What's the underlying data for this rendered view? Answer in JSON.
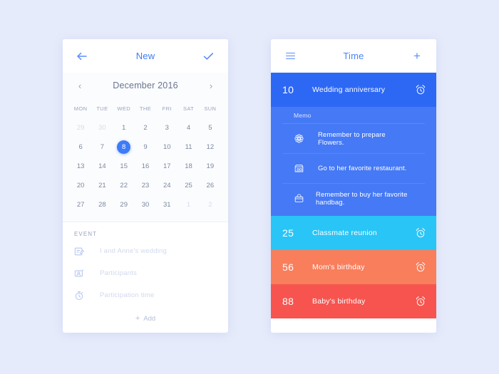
{
  "colors": {
    "page_background": "#e6ebfb",
    "accent_blue": "#3d7bf7",
    "row_blue": "#2d68f5",
    "memo_blue": "#4579f5",
    "row_cyan": "#29c5f6",
    "row_orange": "#f97e5c",
    "row_red": "#f7544f"
  },
  "left_panel": {
    "appbar": {
      "back_icon": "arrow-left-icon",
      "title": "New",
      "confirm_icon": "check-icon"
    },
    "month_nav": {
      "prev_icon": "chevron-left-icon",
      "label": "December 2016",
      "next_icon": "chevron-right-icon"
    },
    "calendar": {
      "weekdays": [
        "MON",
        "TUE",
        "WED",
        "THE",
        "FRI",
        "SAT",
        "SUN"
      ],
      "selected_day": 8,
      "weeks": [
        [
          {
            "n": "29",
            "muted": true
          },
          {
            "n": "30",
            "muted": true
          },
          {
            "n": "1",
            "muted": false
          },
          {
            "n": "2",
            "muted": false
          },
          {
            "n": "3",
            "muted": false
          },
          {
            "n": "4",
            "muted": false
          },
          {
            "n": "5",
            "muted": false
          }
        ],
        [
          {
            "n": "6",
            "muted": false
          },
          {
            "n": "7",
            "muted": false
          },
          {
            "n": "8",
            "muted": false,
            "selected": true
          },
          {
            "n": "9",
            "muted": false
          },
          {
            "n": "10",
            "muted": false
          },
          {
            "n": "11",
            "muted": false
          },
          {
            "n": "12",
            "muted": false
          }
        ],
        [
          {
            "n": "13",
            "muted": false
          },
          {
            "n": "14",
            "muted": false
          },
          {
            "n": "15",
            "muted": false
          },
          {
            "n": "16",
            "muted": false
          },
          {
            "n": "17",
            "muted": false
          },
          {
            "n": "18",
            "muted": false
          },
          {
            "n": "19",
            "muted": false
          }
        ],
        [
          {
            "n": "20",
            "muted": false
          },
          {
            "n": "21",
            "muted": false
          },
          {
            "n": "22",
            "muted": false
          },
          {
            "n": "23",
            "muted": false
          },
          {
            "n": "24",
            "muted": false
          },
          {
            "n": "25",
            "muted": false
          },
          {
            "n": "26",
            "muted": false
          }
        ],
        [
          {
            "n": "27",
            "muted": false
          },
          {
            "n": "28",
            "muted": false
          },
          {
            "n": "29",
            "muted": false
          },
          {
            "n": "30",
            "muted": false
          },
          {
            "n": "31",
            "muted": false
          },
          {
            "n": "1",
            "muted": true
          },
          {
            "n": "2",
            "muted": true
          }
        ]
      ]
    },
    "event_section": {
      "title": "EVENT",
      "rows": [
        {
          "icon": "edit-note-icon",
          "placeholder": "I and Anne's wedding"
        },
        {
          "icon": "contact-card-icon",
          "placeholder": "Participants"
        },
        {
          "icon": "stopwatch-icon",
          "placeholder": "Participation time"
        }
      ],
      "add_label": "Add",
      "add_icon": "plus-icon"
    }
  },
  "right_panel": {
    "appbar": {
      "menu_icon": "hamburger-menu-icon",
      "title": "Time",
      "add_icon": "plus-icon"
    },
    "featured_event": {
      "day": "10",
      "name": "Wedding anniversary",
      "alarm_icon": "alarm-clock-icon",
      "color": "#2d68f5"
    },
    "memo": {
      "label": "Memo",
      "items": [
        {
          "icon": "flower-icon",
          "text": "Remember to prepare Flowers."
        },
        {
          "icon": "restaurant-icon",
          "text": "Go to her favorite restaurant."
        },
        {
          "icon": "handbag-icon",
          "text": "Remember to buy her favorite handbag."
        }
      ]
    },
    "events": [
      {
        "day": "25",
        "name": "Classmate reunion",
        "alarm_icon": "alarm-clock-icon",
        "color": "#29c5f6"
      },
      {
        "day": "56",
        "name": "Mom's birthday",
        "alarm_icon": "alarm-clock-icon",
        "color": "#f97e5c"
      },
      {
        "day": "88",
        "name": "Baby's birthday",
        "alarm_icon": "alarm-clock-icon",
        "color": "#f7544f"
      }
    ]
  }
}
